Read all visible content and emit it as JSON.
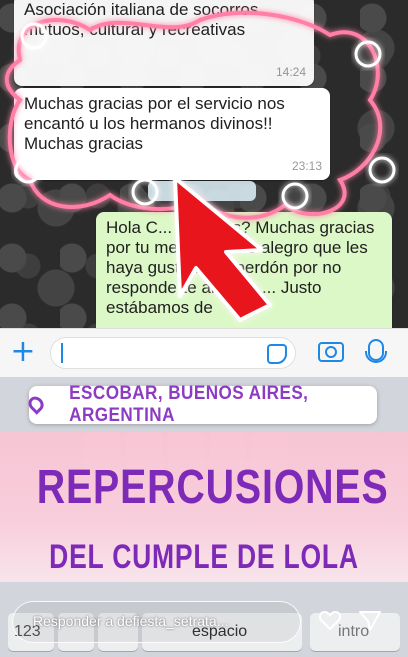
{
  "chat": {
    "msg1": {
      "text": "Asociación italiana de socorros mutuos, cultural y recreativas",
      "time": "14:24"
    },
    "msg2": {
      "text": "Muchas gracias por el servicio nos encantó u los hermanos divinos!! Muchas gracias",
      "time": "23:13"
    },
    "msg3": {
      "text": "Hola C... no estás? Muchas gracias por tu mensaje . Me alegro que les haya gustado ; y perdón por no responderte anoche ... Justo estábamos de"
    }
  },
  "input_bar": {
    "plus_icon": "plus-icon",
    "sticker_icon": "sticker-icon",
    "camera_icon": "camera-icon",
    "mic_icon": "microphone-icon",
    "accent": "#1e88e5"
  },
  "keyboard": {
    "numbers_key": "123",
    "space_key": "espacio",
    "return_key": "intro"
  },
  "story": {
    "location": "ESCOBAR, BUENOS AIRES, ARGENTINA",
    "title": "REPERCUSIONES",
    "subtitle": "DEL CUMPLE DE LOLA",
    "text_color": "#7e2ab8",
    "band_color": "#f8c4d4",
    "doodle_color": "#ff2f6d",
    "arrow_color": "#e8141e"
  },
  "reply": {
    "placeholder": "Responder a defiesta_setrata..."
  }
}
